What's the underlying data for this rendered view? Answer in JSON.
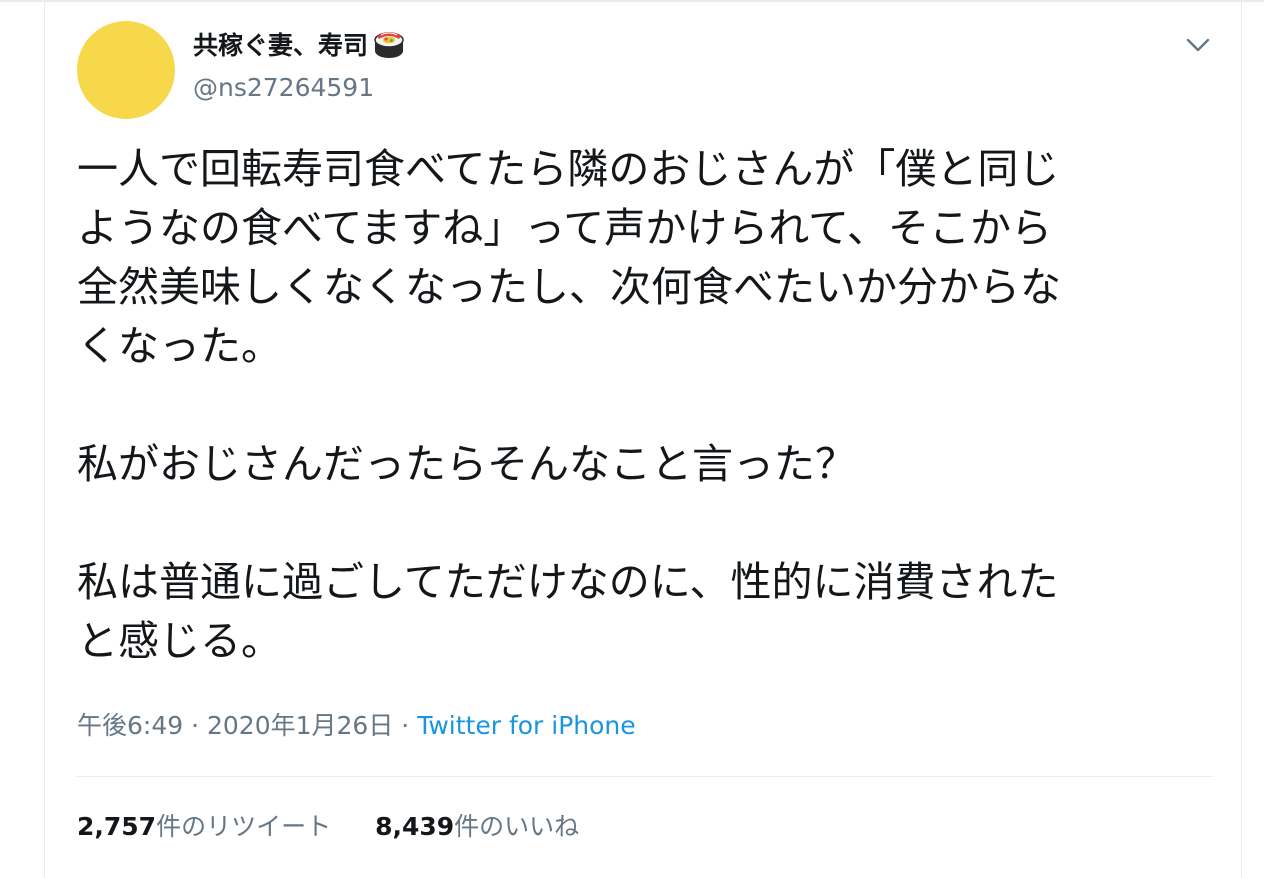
{
  "tweet": {
    "author": {
      "display_name": "共稼ぐ妻、寿司",
      "handle": "@ns27264591",
      "avatar_color": "#f6d84a",
      "name_emoji": "sushi-icon"
    },
    "text_lines": [
      "一人で回転寿司食べてたら隣のおじさんが「僕と同じ",
      "ようなの食べてますね」って声かけられて、そこから",
      "全然美味しくなくなったし、次何食べたいか分からな",
      "くなった。",
      "",
      "私がおじさんだったらそんなこと言った？",
      "",
      "私は普通に過ごしてただけなのに、性的に消費された",
      "と感じる。"
    ],
    "time": "午後6:49",
    "date": "2020年1月26日",
    "separator": "·",
    "source": "Twitter for iPhone",
    "retweets": {
      "count": "2,757",
      "label": "件のリツイート"
    },
    "likes": {
      "count": "8,439",
      "label": "件のいいね"
    }
  },
  "colors": {
    "text": "#14171a",
    "secondary": "#657786",
    "link": "#1b95e0",
    "border": "#e6ecf0"
  }
}
